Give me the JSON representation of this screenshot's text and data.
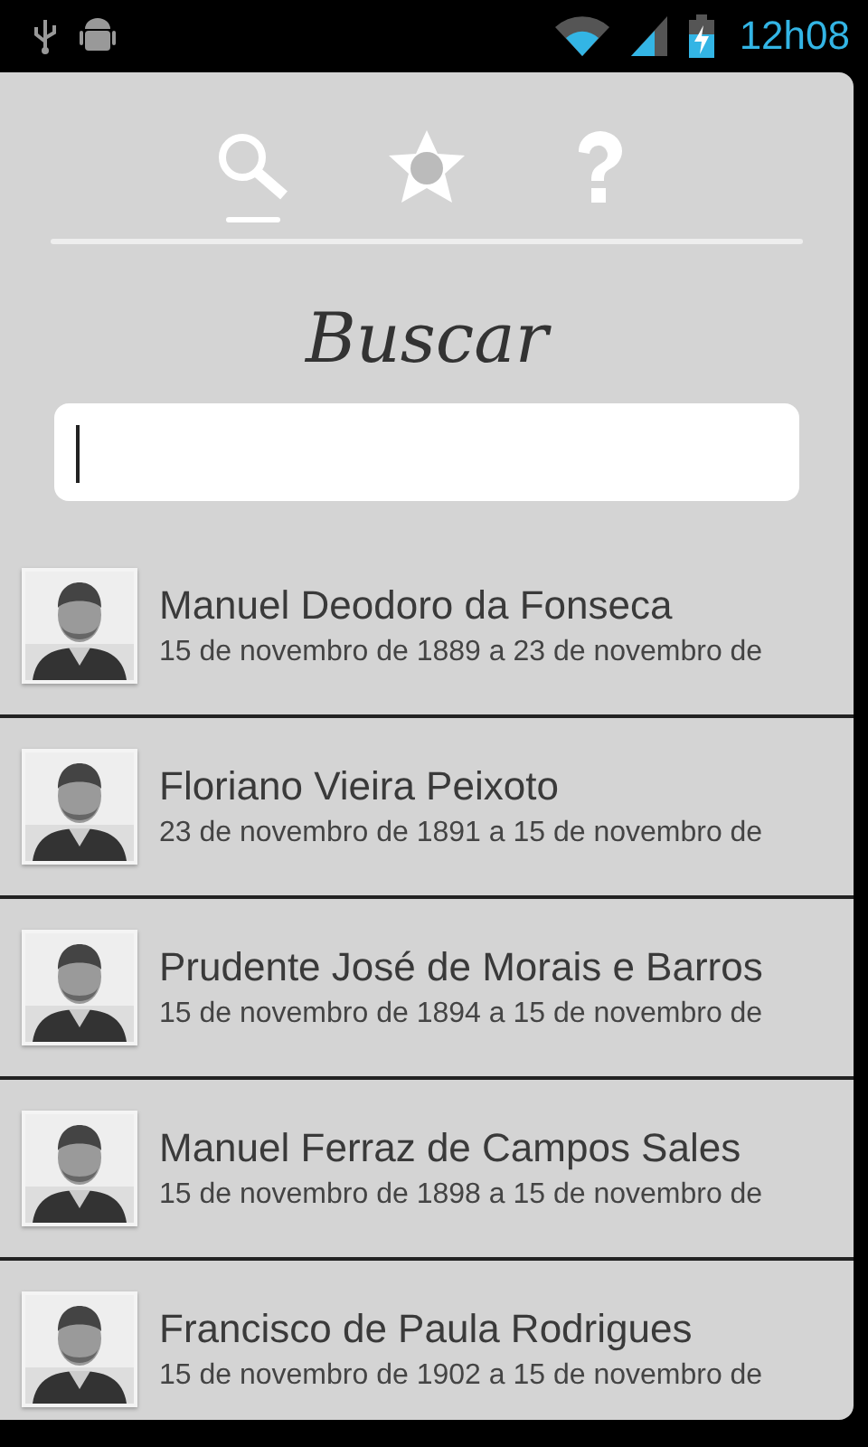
{
  "status_bar": {
    "time": "12h08"
  },
  "tabs": [
    {
      "kind": "search",
      "selected": true
    },
    {
      "kind": "favorites",
      "selected": false
    },
    {
      "kind": "help",
      "selected": false
    }
  ],
  "title": "Buscar",
  "presidents": [
    {
      "name": "Manuel Deodoro da Fonseca",
      "term": "15 de novembro de 1889 a 23 de novembro de"
    },
    {
      "name": "Floriano Vieira Peixoto",
      "term": "23 de novembro de 1891 a 15 de novembro de"
    },
    {
      "name": "Prudente José de Morais e Barros",
      "term": "15 de novembro de 1894 a 15 de novembro de"
    },
    {
      "name": "Manuel Ferraz de Campos Sales",
      "term": "15 de novembro de 1898 a 15 de novembro de"
    },
    {
      "name": "Francisco de Paula Rodrigues",
      "term": "15 de novembro de 1902 a 15 de novembro de"
    }
  ]
}
